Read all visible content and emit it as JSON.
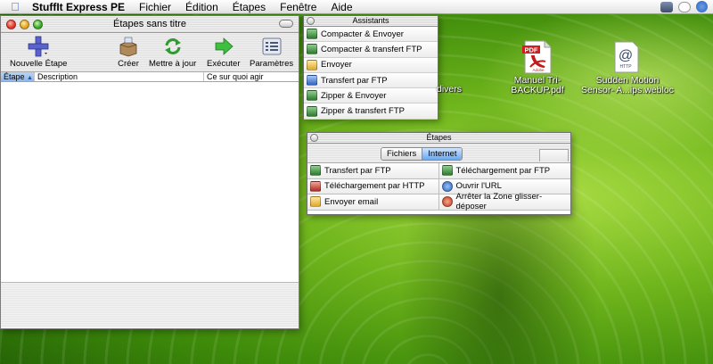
{
  "menubar": {
    "app_name": "StuffIt Express PE",
    "menus": [
      "Fichier",
      "Édition",
      "Étapes",
      "Fenêtre",
      "Aide"
    ]
  },
  "main_window": {
    "title": "Étapes sans titre",
    "toolbar": {
      "new_step": "Nouvelle Étape",
      "create": "Créer",
      "update": "Mettre à jour",
      "execute": "Exécuter",
      "settings": "Paramètres"
    },
    "columns": [
      "Étape",
      "Description",
      "Ce sur quoi agir"
    ]
  },
  "assistants": {
    "title": "Assistants",
    "items": [
      {
        "label": "Compacter & Envoyer",
        "color": "#3a8a3a"
      },
      {
        "label": "Compacter & transfert FTP",
        "color": "#3a8a3a"
      },
      {
        "label": "Envoyer",
        "color": "#e9b83a"
      },
      {
        "label": "Transfert par FTP",
        "color": "#3c7bd8"
      },
      {
        "label": "Zipper & Envoyer",
        "color": "#3a8a3a"
      },
      {
        "label": "Zipper & transfert FTP",
        "color": "#3a8a3a"
      }
    ]
  },
  "etapes": {
    "title": "Étapes",
    "tabs": [
      "Fichiers",
      "Internet"
    ],
    "active_tab": "Internet",
    "items": [
      {
        "label": "Transfert par FTP",
        "color": "#3a8a3a"
      },
      {
        "label": "Téléchargement par FTP",
        "color": "#3a8a3a"
      },
      {
        "label": "Téléchargement par HTTP",
        "color": "#c0392b"
      },
      {
        "label": "Ouvrir l'URL",
        "color": "#3c7bd8"
      },
      {
        "label": "Envoyer email",
        "color": "#e9b83a"
      },
      {
        "label": "Arrêter la Zone glisser-déposer",
        "color": "#c0392b"
      }
    ]
  },
  "desktop": {
    "partial_label": "divers",
    "pdf_badge": "PDF",
    "pdf_brand": "Adobe",
    "pdf_file": [
      "Manuel Tri-",
      "BACKUP.pdf"
    ],
    "webloc_symbol": "@",
    "webloc_badge": "HTTP",
    "webloc_file": [
      "Sudden Motion",
      "Sensor- A...ips.webloc"
    ]
  }
}
